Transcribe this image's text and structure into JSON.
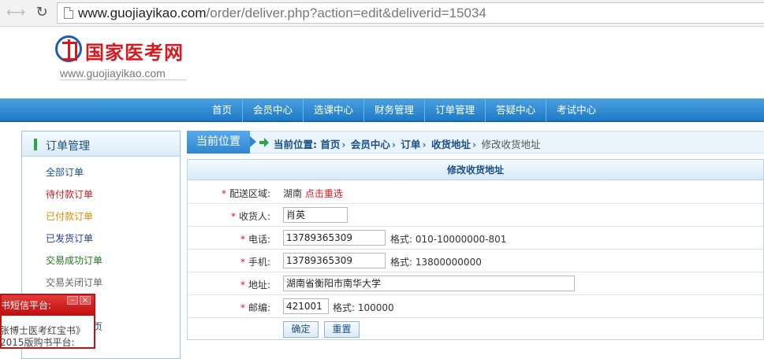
{
  "browser": {
    "url_domain": "www.guojiayikao.com",
    "url_path": "/order/deliver.php?action=edit&deliverid=15034"
  },
  "site": {
    "logo_text": "国家医考网",
    "logo_sub": "www.guojiayikao.com"
  },
  "mainnav": [
    "首页",
    "会员中心",
    "选课中心",
    "财务管理",
    "订单管理",
    "答疑中心",
    "考试中心"
  ],
  "sidebar": {
    "title": "订单管理",
    "items": [
      {
        "label": "全部订单",
        "color": "#1a4f86"
      },
      {
        "label": "待付款订单",
        "color": "#d7181f"
      },
      {
        "label": "已付款订单",
        "color": "#e08a00"
      },
      {
        "label": "已发货订单",
        "color": "#1f3fa0"
      },
      {
        "label": "交易成功订单",
        "color": "#1f7a1f"
      },
      {
        "label": "交易关闭订单",
        "color": "#666666"
      }
    ],
    "partial_item": "页"
  },
  "popup": {
    "title": "书短信平台:",
    "line1": "张博士医考红宝书》",
    "line2": "2015版购书平台:"
  },
  "breadcrumb": {
    "label": "当前位置",
    "prefix": "当前位置:",
    "items": [
      "首页",
      "会员中心",
      "订单",
      "收货地址"
    ],
    "current": "修改收货地址"
  },
  "form": {
    "title": "修改收货地址",
    "region": {
      "label": "配送区域:",
      "value": "湖南",
      "reselect": "点击重选"
    },
    "receiver": {
      "label": "收货人:",
      "value": "肖英"
    },
    "phone": {
      "label": "电话:",
      "value": "13789365309",
      "hint": "格式: 010-10000000-801"
    },
    "mobile": {
      "label": "手机:",
      "value": "13789365309",
      "hint": "格式: 13800000000"
    },
    "address": {
      "label": "地址:",
      "value": "湖南省衡阳市南华大学"
    },
    "zipcode": {
      "label": "邮编:",
      "value": "421001",
      "hint": "格式: 100000"
    },
    "confirm_label": "确定",
    "reset_label": "重置"
  }
}
